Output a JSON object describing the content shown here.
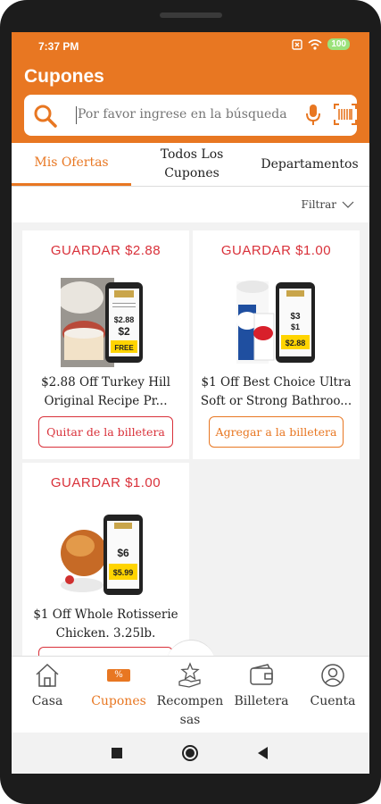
{
  "status": {
    "time": "7:37 PM",
    "battery": "100"
  },
  "header": {
    "title": "Cupones"
  },
  "search": {
    "placeholder": "Por favor ingrese en la búsqueda"
  },
  "tabs": [
    {
      "label": "Mis Ofertas",
      "active": true
    },
    {
      "label": "Todos Los Cupones"
    },
    {
      "label": "Departamentos"
    }
  ],
  "filter": {
    "label": "Filtrar"
  },
  "coupons": [
    {
      "save": "GUARDAR $2.88",
      "desc": "$2.88 Off Turkey Hill Original Recipe Pr...",
      "button": "Quitar de la billetera",
      "phone_price": "$2.88"
    },
    {
      "save": "GUARDAR $1.00",
      "desc": "$1 Off Best Choice Ultra Soft or Strong Bathroo...",
      "button": "Agregar a la billetera",
      "phone_price": "$2.88"
    },
    {
      "save": "GUARDAR $1.00",
      "desc": "$1 Off Whole Rotisserie Chicken. 3.25lb.",
      "button": "",
      "phone_price": "$5.99"
    }
  ],
  "nav": [
    {
      "label": "Casa",
      "icon": "home-icon"
    },
    {
      "label": "Cupones",
      "icon": "coupon-icon",
      "badge": "%",
      "active": true
    },
    {
      "label": "Recompensas",
      "icon": "rewards-icon"
    },
    {
      "label": "Billetera",
      "icon": "wallet-icon"
    },
    {
      "label": "Cuenta",
      "icon": "account-icon"
    }
  ],
  "colors": {
    "brand": "#e87722",
    "save_red": "#d9313a"
  }
}
